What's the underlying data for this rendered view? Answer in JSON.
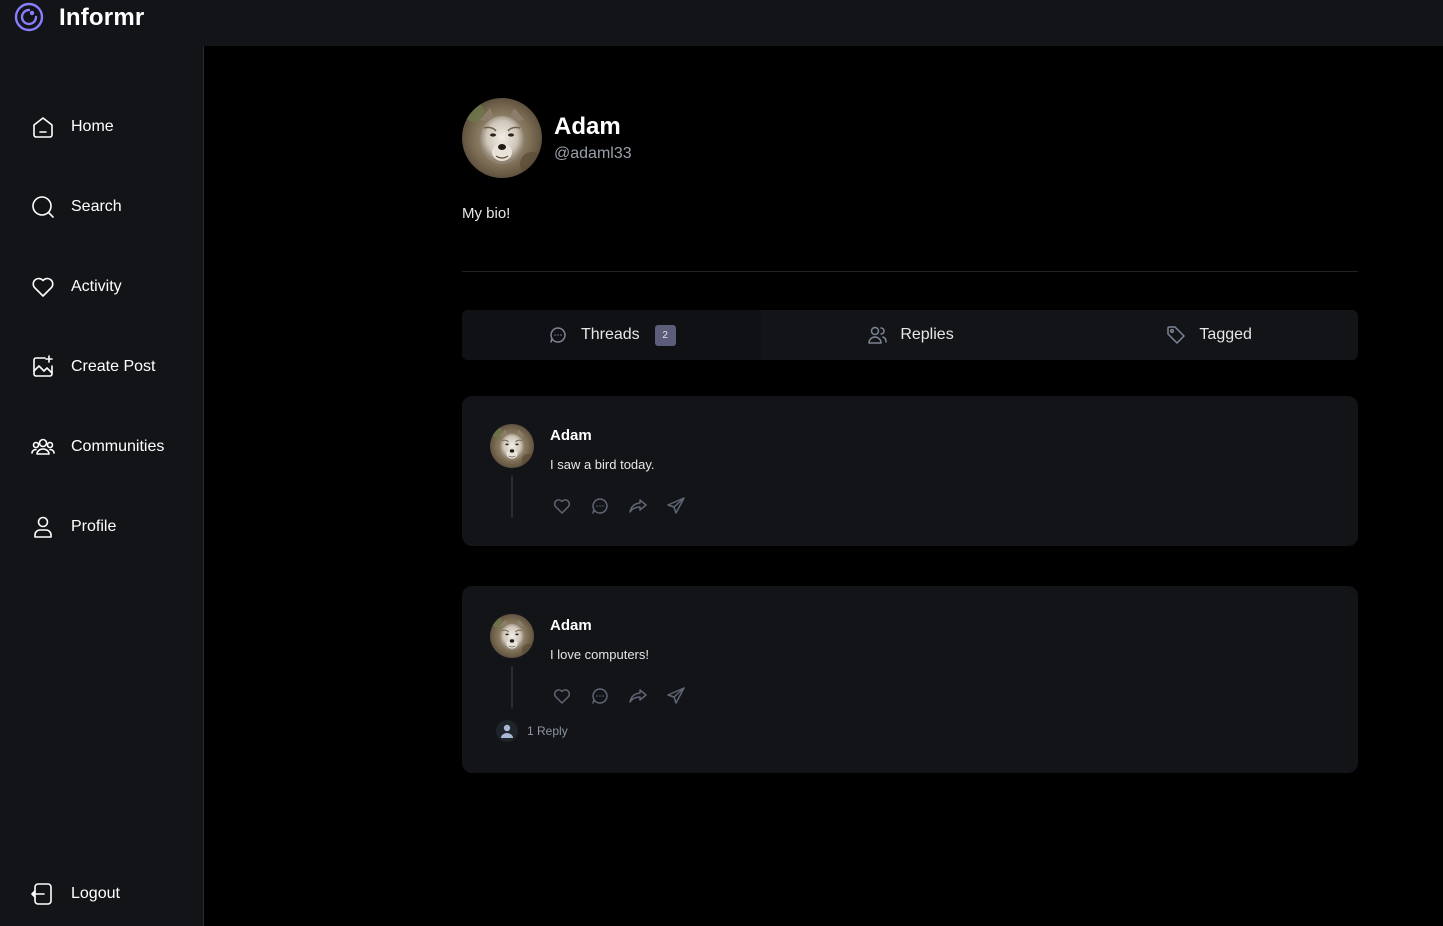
{
  "app": {
    "title": "Informr",
    "accent": "#877eff"
  },
  "sidebar": {
    "items": [
      {
        "label": "Home",
        "icon": "home-icon"
      },
      {
        "label": "Search",
        "icon": "search-icon"
      },
      {
        "label": "Activity",
        "icon": "heart-icon"
      },
      {
        "label": "Create Post",
        "icon": "image-plus-icon"
      },
      {
        "label": "Communities",
        "icon": "users-icon"
      },
      {
        "label": "Profile",
        "icon": "user-icon"
      }
    ],
    "logout": {
      "label": "Logout",
      "icon": "logout-icon"
    }
  },
  "profile": {
    "name": "Adam",
    "handle": "@adaml33",
    "bio": "My bio!"
  },
  "tabs": [
    {
      "label": "Threads",
      "icon": "chat-bubble-icon",
      "count": "2",
      "active": true
    },
    {
      "label": "Replies",
      "icon": "users-icon",
      "active": false
    },
    {
      "label": "Tagged",
      "icon": "tag-icon",
      "active": false
    }
  ],
  "threads": [
    {
      "author": "Adam",
      "content": "I saw a bird today.",
      "replies_label": ""
    },
    {
      "author": "Adam",
      "content": "I love computers!",
      "replies_label": "1 Reply"
    }
  ]
}
